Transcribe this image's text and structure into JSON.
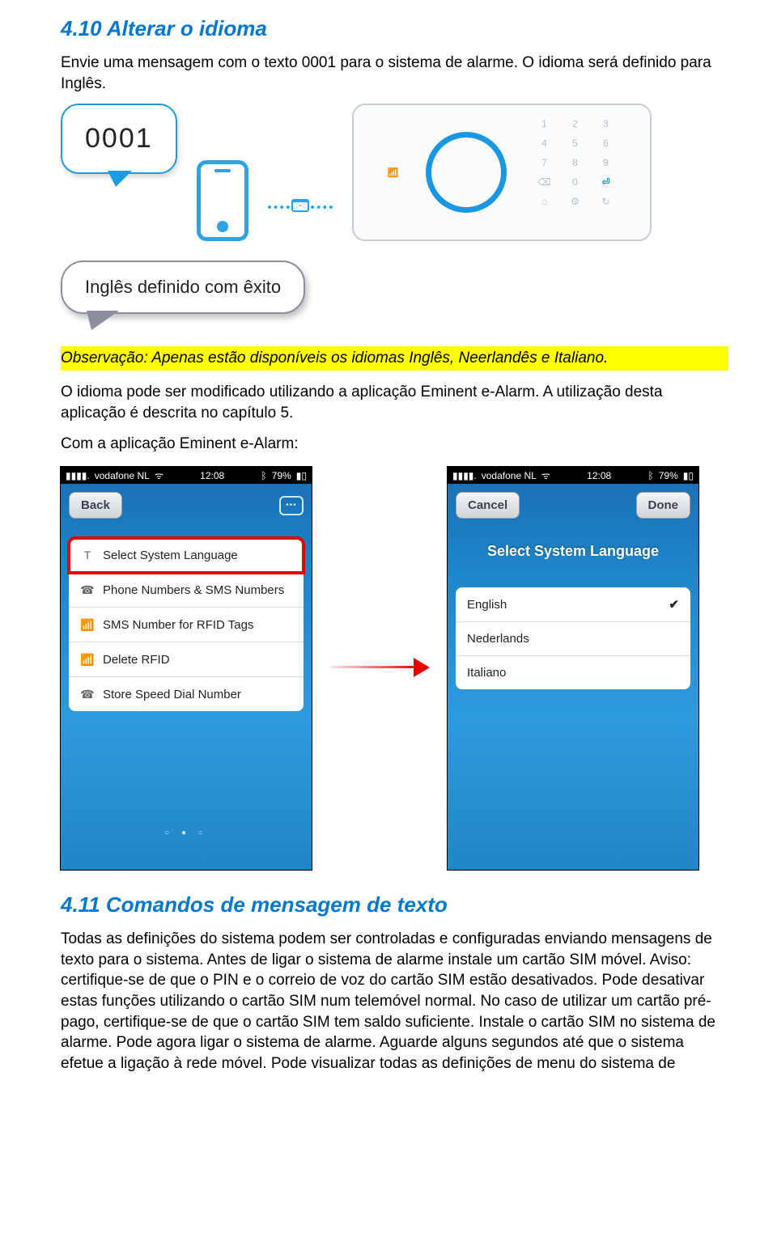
{
  "section1": {
    "heading": "4.10 Alterar o idioma",
    "intro": "Envie uma mensagem com o texto 0001 para o sistema de alarme. O idioma será definido para Inglês.",
    "bubble_code": "0001",
    "keypad": [
      "1",
      "2",
      "3",
      "4",
      "5",
      "6",
      "7",
      "8",
      "9",
      "⌫",
      "0",
      "⏎",
      "⌂",
      "⚙",
      "↻"
    ],
    "callout": "Inglês definido com êxito",
    "highlight": "Observação: Apenas estão disponíveis os idiomas Inglês, Neerlandês e Italiano.",
    "para1": "O idioma pode ser modificado utilizando a aplicação Eminent e-Alarm. A utilização desta aplicação é descrita no capítulo 5.",
    "para2": "Com a aplicação Eminent e-Alarm:"
  },
  "phone_status": {
    "carrier": "vodafone NL",
    "time": "12:08",
    "battery": "79%"
  },
  "phone_left": {
    "nav_back": "Back",
    "items": [
      {
        "icon": "T",
        "label": "Select System Language"
      },
      {
        "icon": "☎",
        "label": "Phone Numbers & SMS Numbers"
      },
      {
        "icon": "📶",
        "label": "SMS Number for RFID Tags"
      },
      {
        "icon": "📶",
        "label": "Delete RFID"
      },
      {
        "icon": "☎",
        "label": "Store Speed Dial Number"
      }
    ],
    "pager": "○ ● ○"
  },
  "phone_right": {
    "nav_cancel": "Cancel",
    "nav_done": "Done",
    "title": "Select System Language",
    "languages": [
      {
        "label": "English",
        "selected": true
      },
      {
        "label": "Nederlands",
        "selected": false
      },
      {
        "label": "Italiano",
        "selected": false
      }
    ]
  },
  "section2": {
    "heading": "4.11 Comandos de mensagem de texto",
    "body": "Todas as definições do sistema podem ser controladas e configuradas enviando mensagens de texto para o sistema. Antes de ligar o sistema de alarme instale um cartão SIM móvel. Aviso: certifique-se de que o PIN e o correio de voz do cartão SIM estão desativados. Pode desativar estas funções utilizando o cartão SIM num telemóvel normal. No caso de utilizar um cartão pré-pago, certifique-se de que o cartão SIM tem saldo suficiente. Instale o cartão SIM no sistema de alarme. Pode agora ligar o sistema de alarme. Aguarde alguns segundos até que o sistema efetue a ligação à rede móvel. Pode visualizar todas as definições de menu do sistema de"
  }
}
